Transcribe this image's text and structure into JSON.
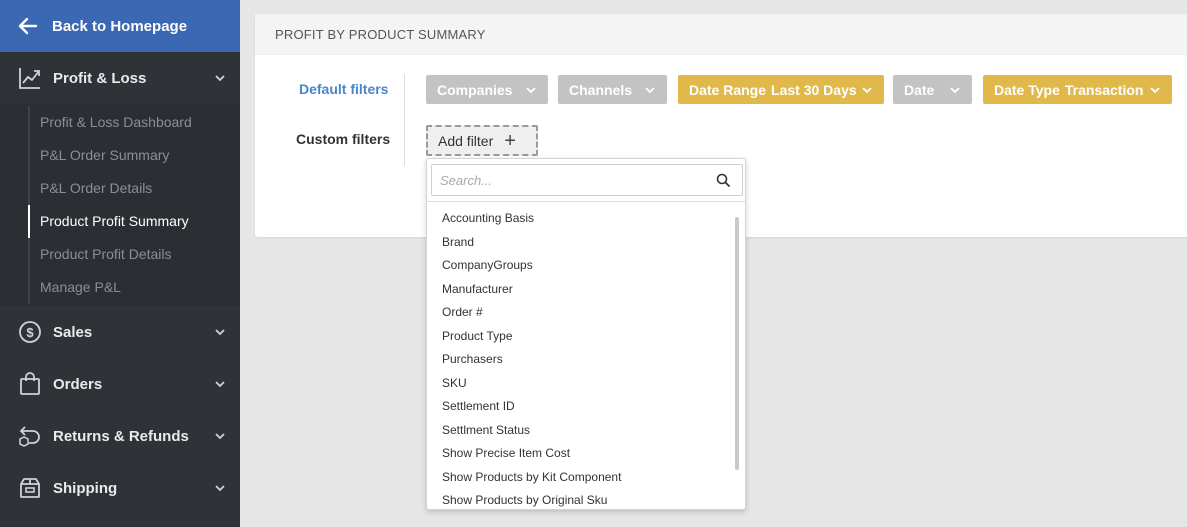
{
  "sidebar": {
    "back_label": "Back to Homepage",
    "sections": [
      {
        "label": "Profit & Loss",
        "icon": "chart-line-icon"
      },
      {
        "label": "Sales",
        "icon": "dollar-icon"
      },
      {
        "label": "Orders",
        "icon": "shopping-bag-icon"
      },
      {
        "label": "Returns & Refunds",
        "icon": "return-box-icon"
      },
      {
        "label": "Shipping",
        "icon": "shipping-box-icon"
      }
    ],
    "sub_items": [
      "Profit & Loss Dashboard",
      "P&L Order Summary",
      "P&L Order Details",
      "Product Profit Summary",
      "Product Profit Details",
      "Manage P&L"
    ],
    "current_sub_item": "Product Profit Summary"
  },
  "panel": {
    "title": "PROFIT BY PRODUCT SUMMARY",
    "default_filters_label": "Default filters",
    "custom_filters_label": "Custom filters",
    "filters": [
      {
        "label": "Companies",
        "value": ""
      },
      {
        "label": "Channels",
        "value": ""
      },
      {
        "label": "Date Range",
        "value": "Last 30 Days"
      },
      {
        "label": "Date",
        "value": ""
      },
      {
        "label": "Date Type",
        "value": "Transaction"
      }
    ],
    "add_filter_label": "Add filter"
  },
  "dropdown": {
    "search_placeholder": "Search...",
    "options": [
      "Accounting Basis",
      "Brand",
      "CompanyGroups",
      "Manufacturer",
      "Order #",
      "Product Type",
      "Purchasers",
      "SKU",
      "Settlement ID",
      "Settlment Status",
      "Show Precise Item Cost",
      "Show Products by Kit Component",
      "Show Products by Original Sku"
    ]
  },
  "colors": {
    "sidebar_bg": "#2f3338",
    "back_bg": "#3a68b3",
    "chip_gray": "#c3c3c3",
    "chip_gold": "#e1b94a",
    "default_label": "#4a86c5"
  }
}
